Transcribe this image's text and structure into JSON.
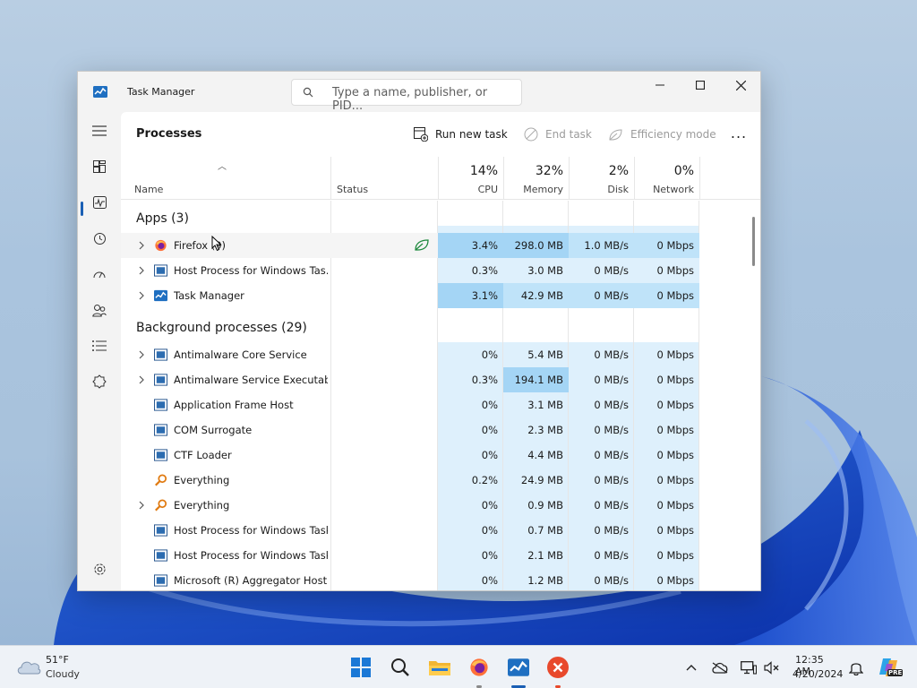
{
  "window": {
    "title": "Task Manager",
    "search_placeholder": "Type a name, publisher, or PID..."
  },
  "toolbar": {
    "page_title": "Processes",
    "run_new_task": "Run new task",
    "end_task": "End task",
    "efficiency_mode": "Efficiency mode",
    "more": "..."
  },
  "nav_icons": [
    "hamburger-icon",
    "processes-icon",
    "performance-icon",
    "app-history-icon",
    "startup-apps-icon",
    "users-icon",
    "details-icon",
    "services-icon",
    "settings-icon"
  ],
  "columns": {
    "name": "Name",
    "status": "Status",
    "cpu_pct": "14%",
    "cpu": "CPU",
    "mem_pct": "32%",
    "mem": "Memory",
    "disk_pct": "2%",
    "disk": "Disk",
    "net_pct": "0%",
    "net": "Network"
  },
  "groups": {
    "apps": "Apps (3)",
    "background": "Background processes (29)"
  },
  "apps": [
    {
      "name": "Firefox (9)",
      "cpu": "3.4%",
      "mem": "298.0 MB",
      "disk": "1.0 MB/s",
      "net": "0 Mbps"
    },
    {
      "name": "Host Process for Windows Tas...",
      "cpu": "0.3%",
      "mem": "3.0 MB",
      "disk": "0 MB/s",
      "net": "0 Mbps"
    },
    {
      "name": "Task Manager",
      "cpu": "3.1%",
      "mem": "42.9 MB",
      "disk": "0 MB/s",
      "net": "0 Mbps"
    }
  ],
  "background": [
    {
      "name": "Antimalware Core Service",
      "cpu": "0%",
      "mem": "5.4 MB",
      "disk": "0 MB/s",
      "net": "0 Mbps"
    },
    {
      "name": "Antimalware Service Executable",
      "cpu": "0.3%",
      "mem": "194.1 MB",
      "disk": "0 MB/s",
      "net": "0 Mbps"
    },
    {
      "name": "Application Frame Host",
      "cpu": "0%",
      "mem": "3.1 MB",
      "disk": "0 MB/s",
      "net": "0 Mbps"
    },
    {
      "name": "COM Surrogate",
      "cpu": "0%",
      "mem": "2.3 MB",
      "disk": "0 MB/s",
      "net": "0 Mbps"
    },
    {
      "name": "CTF Loader",
      "cpu": "0%",
      "mem": "4.4 MB",
      "disk": "0 MB/s",
      "net": "0 Mbps"
    },
    {
      "name": "Everything",
      "cpu": "0.2%",
      "mem": "24.9 MB",
      "disk": "0 MB/s",
      "net": "0 Mbps"
    },
    {
      "name": "Everything",
      "cpu": "0%",
      "mem": "0.9 MB",
      "disk": "0 MB/s",
      "net": "0 Mbps"
    },
    {
      "name": "Host Process for Windows Tasks",
      "cpu": "0%",
      "mem": "0.7 MB",
      "disk": "0 MB/s",
      "net": "0 Mbps"
    },
    {
      "name": "Host Process for Windows Tasks",
      "cpu": "0%",
      "mem": "2.1 MB",
      "disk": "0 MB/s",
      "net": "0 Mbps"
    },
    {
      "name": "Microsoft (R) Aggregator Host",
      "cpu": "0%",
      "mem": "1.2 MB",
      "disk": "0 MB/s",
      "net": "0 Mbps"
    }
  ],
  "taskbar": {
    "weather_temp": "51°F",
    "weather_desc": "Cloudy",
    "clock_time": "12:35 AM",
    "clock_date": "4/20/2024",
    "copilot_badge": "PRE"
  },
  "colors": {
    "accent": "#1a5fb4",
    "heat_low": "#def0fc",
    "heat_mid": "#bfe3f9",
    "heat_high": "#a4d5f5"
  }
}
